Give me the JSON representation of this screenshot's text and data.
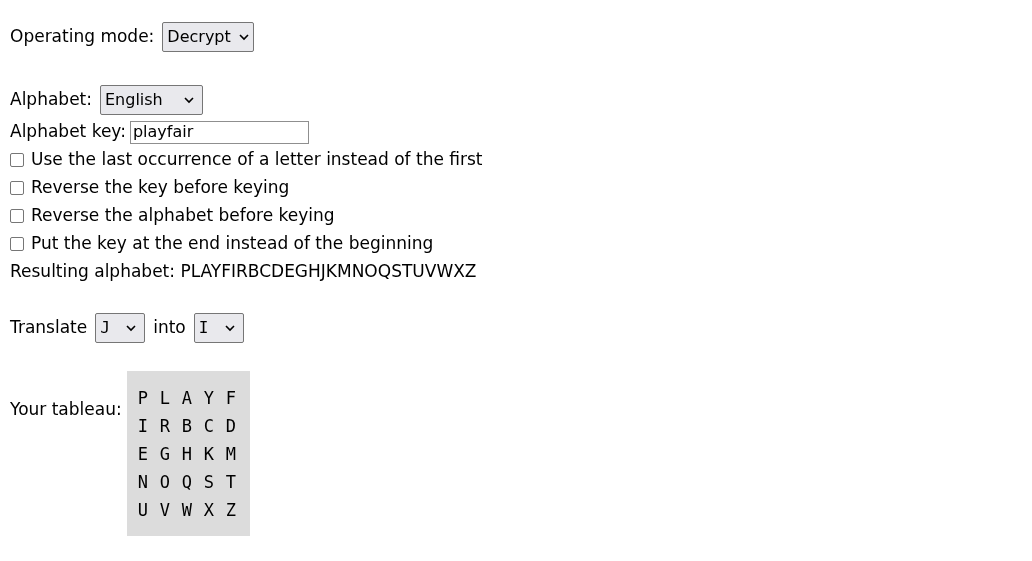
{
  "operating_mode": {
    "label": "Operating mode:",
    "value": "Decrypt"
  },
  "alphabet": {
    "label": "Alphabet:",
    "value": "English"
  },
  "alphabet_key": {
    "label": "Alphabet key:",
    "value": "playfair"
  },
  "options": [
    {
      "label": "Use the last occurrence of a letter instead of the first",
      "checked": false
    },
    {
      "label": "Reverse the key before keying",
      "checked": false
    },
    {
      "label": "Reverse the alphabet before keying",
      "checked": false
    },
    {
      "label": "Put the key at the end instead of the beginning",
      "checked": false
    }
  ],
  "resulting_alphabet": "Resulting alphabet: PLAYFIRBCDEGHJKMNOQSTUVWXZ",
  "translate": {
    "label": "Translate",
    "from": "J",
    "into_label": "into",
    "to": "I"
  },
  "tableau": {
    "label": "Your tableau:",
    "rows": [
      [
        "P",
        "L",
        "A",
        "Y",
        "F"
      ],
      [
        "I",
        "R",
        "B",
        "C",
        "D"
      ],
      [
        "E",
        "G",
        "H",
        "K",
        "M"
      ],
      [
        "N",
        "O",
        "Q",
        "S",
        "T"
      ],
      [
        "U",
        "V",
        "W",
        "X",
        "Z"
      ]
    ]
  }
}
